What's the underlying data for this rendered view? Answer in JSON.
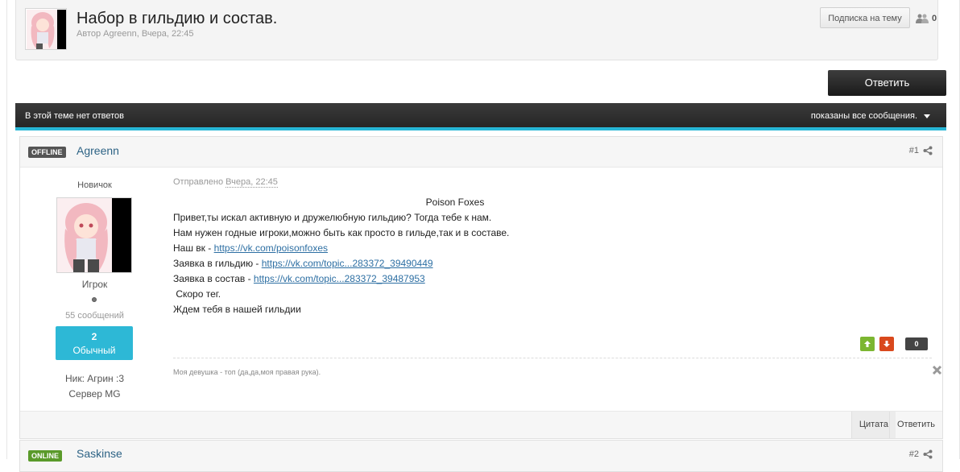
{
  "topic": {
    "title": "Набор в гильдию и состав.",
    "meta": "Автор Agreenn, Вчера, 22:45",
    "subscribe_label": "Подписка на тему",
    "followers_count": "0"
  },
  "reply_button_label": "Ответить",
  "bar": {
    "left_text": "В этой теме нет ответов",
    "right_text": "показаны все сообщения."
  },
  "post1": {
    "status": "OFFLINE",
    "author": "Agreenn",
    "number": "#1",
    "rank_title": "Новичок",
    "group": "Игрок",
    "posts_count": "55 сообщений",
    "reputation": "2",
    "reputation_label": "Обычный",
    "nick": "Ник: Агрин :3",
    "server": "Сервер MG",
    "posted_prefix": "Отправлено",
    "posted_date": "Вчера, 22:45",
    "content": {
      "heading": "Poison Foxes",
      "line1": "Привет,ты искал активную и дружелюбную гильдию? Тогда тебе к нам.",
      "line2": "Нам нужен годные игроки,можно быть как просто в гильде,так и в составе.",
      "line3_prefix": "Наш вк - ",
      "line3_link": "https://vk.com/poisonfoxes",
      "line4_prefix": "Заявка в гильдию - ",
      "line4_link": "https://vk.com/topic...283372_39490449",
      "line5_prefix": "Заявка в состав - ",
      "line5_link": "https://vk.com/topic...283372_39487953",
      "line6": " Скоро тег.",
      "line7": "Ждем тебя в нашей гильдии"
    },
    "rep_count": "0",
    "signature": "Моя девушка - топ (да,да,моя правая рука).",
    "quote_label": "Цитата",
    "reply_label": "Ответить"
  },
  "post2": {
    "status": "ONLINE",
    "author": "Saskinse",
    "number": "#2"
  },
  "colors": {
    "accent": "#27b6d6",
    "link": "#2d6385",
    "rep_up": "#7cb631",
    "rep_down": "#d9491d"
  }
}
